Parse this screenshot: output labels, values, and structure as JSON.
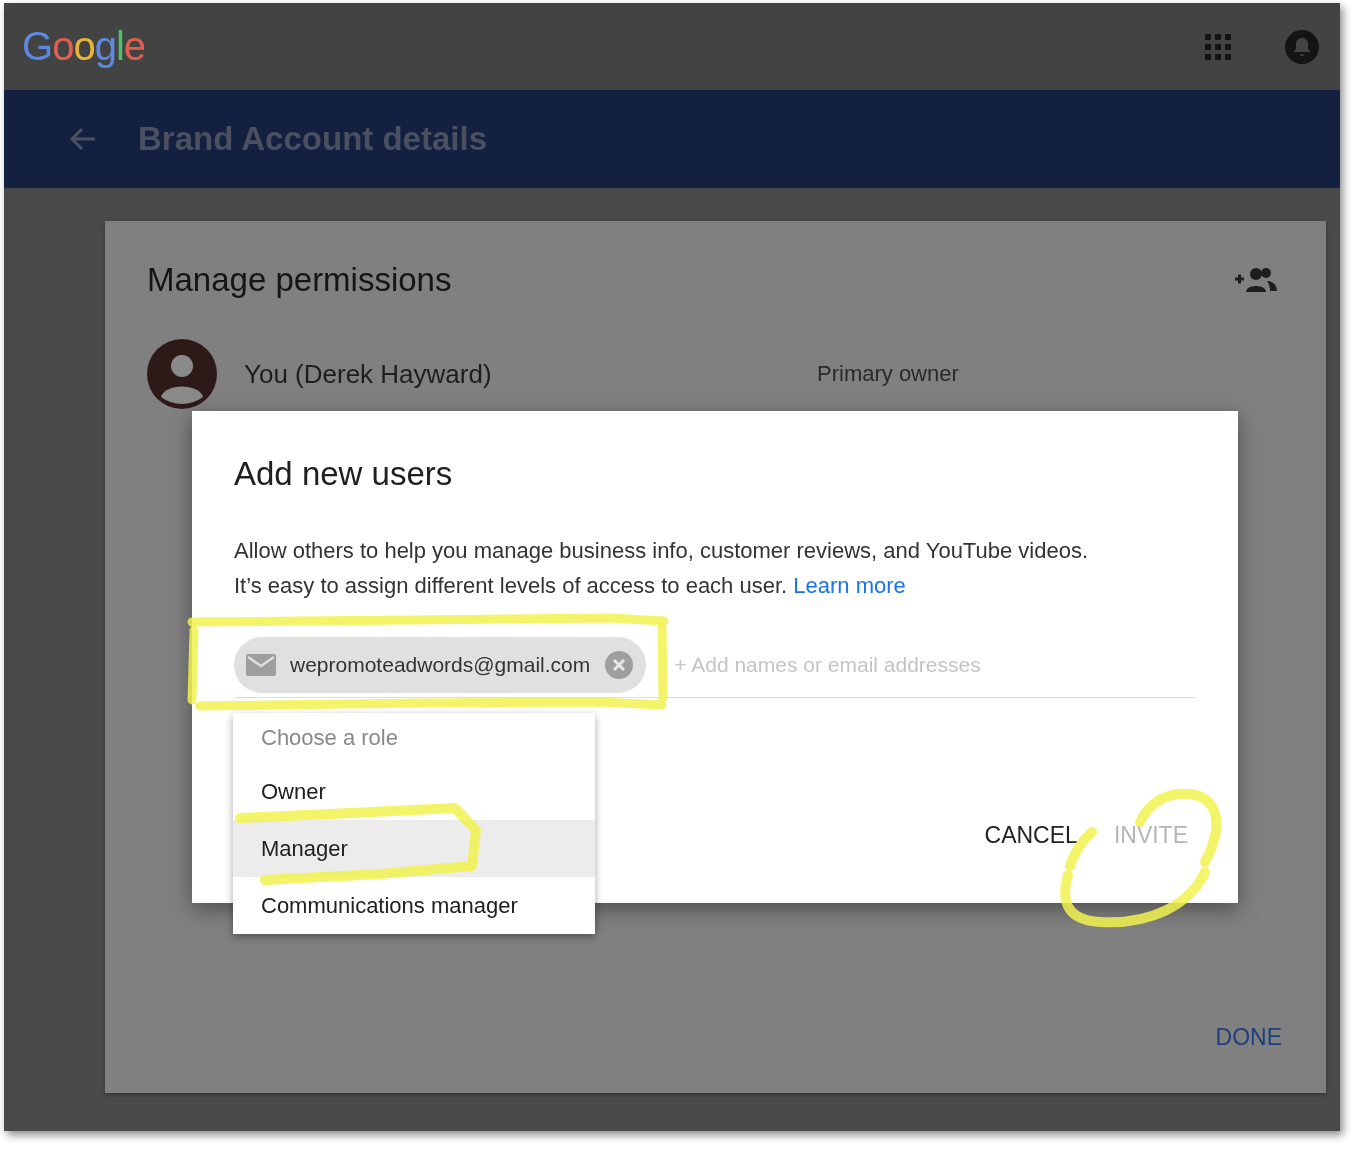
{
  "header": {
    "logo": "Google"
  },
  "title_bar": {
    "title": "Brand Account details"
  },
  "permissions_card": {
    "title": "Manage permissions",
    "users": [
      {
        "name": "You (Derek Hayward)",
        "role": "Primary owner"
      }
    ],
    "done_button": "DONE"
  },
  "dialog": {
    "title": "Add new users",
    "description": "Allow others to help you manage business info, customer reviews, and YouTube videos. It’s easy to assign different levels of access to each user.",
    "learn_more_link": "Learn more",
    "chips": [
      {
        "email": "wepromoteadwords@gmail.com"
      }
    ],
    "input": {
      "placeholder": "+ Add names or email addresses"
    },
    "buttons": [
      {
        "label": "CANCEL",
        "disabled": false
      },
      {
        "label": "INVITE",
        "disabled": true
      }
    ]
  },
  "role_menu": {
    "header": "Choose a role",
    "options": [
      {
        "label": "Owner",
        "selected": false
      },
      {
        "label": "Manager",
        "selected": true
      },
      {
        "label": "Communications manager",
        "selected": false
      }
    ]
  }
}
